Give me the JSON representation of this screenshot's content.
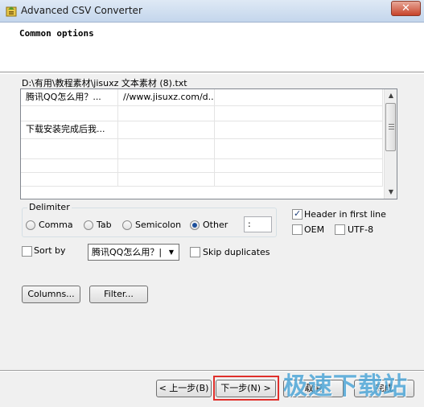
{
  "window": {
    "title": "Advanced CSV Converter",
    "close_glyph": "✕"
  },
  "header": {
    "title": "Common options"
  },
  "file_path": "D:\\有用\\教程素材\\jisuxz 文本素材 (8).txt",
  "grid": {
    "rows": [
      [
        "腾讯QQ怎么用？...",
        "//www.jisuxz.com/d...",
        ""
      ],
      [
        "",
        "",
        ""
      ],
      [
        "下载安装完成后我...",
        "",
        ""
      ],
      [
        "",
        "",
        ""
      ],
      [
        "",
        "",
        ""
      ],
      [
        "",
        "",
        ""
      ]
    ]
  },
  "delimiter": {
    "label": "Delimiter",
    "options": [
      {
        "label": "Comma",
        "selected": false
      },
      {
        "label": "Tab",
        "selected": false
      },
      {
        "label": "Semicolon",
        "selected": false
      },
      {
        "label": "Other",
        "selected": true
      }
    ],
    "other_value": ":"
  },
  "options": {
    "header_first_line": {
      "label": "Header in first line",
      "checked": true
    },
    "oem": {
      "label": "OEM",
      "checked": false
    },
    "utf8": {
      "label": "UTF-8",
      "checked": false
    },
    "sort_by": {
      "label": "Sort by",
      "checked": false,
      "value": "腾讯QQ怎么用？|"
    },
    "skip_duplicates": {
      "label": "Skip duplicates",
      "checked": false
    }
  },
  "buttons": {
    "columns": "Columns...",
    "filter": "Filter...",
    "back": "< 上一步(B)",
    "next": "下一步(N) >",
    "cancel": "取消",
    "finish": "完成"
  },
  "watermark": "极速下载站",
  "colors": {
    "highlight": "#e0302c",
    "watermark": "#4fa7d8"
  }
}
